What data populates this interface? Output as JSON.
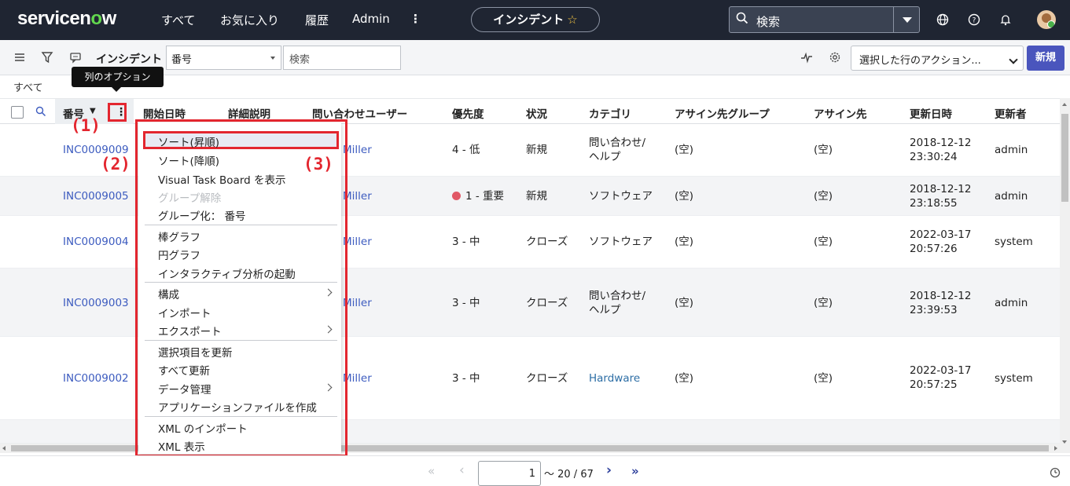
{
  "nav": {
    "logo_pre": "servicen",
    "logo_o": "o",
    "logo_post": "w",
    "links": [
      "すべて",
      "お気に入り",
      "履歴",
      "Admin"
    ],
    "title_pill": "インシデント",
    "search_text": "検索"
  },
  "toolbar": {
    "title": "インシデント",
    "field_select": "番号",
    "search_placeholder": "検索",
    "action_select": "選択した行のアクション...",
    "new_button": "新規"
  },
  "breadcrumb": "すべて",
  "tooltip": "列のオプション",
  "columns": [
    "番号",
    "開始日時",
    "詳細説明",
    "問い合わせユーザー",
    "優先度",
    "状況",
    "カテゴリ",
    "アサイン先グループ",
    "アサイン先",
    "更新日時",
    "更新者"
  ],
  "rows": [
    {
      "number": "INC0009009",
      "caller": "Miller",
      "priority": "4 - 低",
      "critical": false,
      "state": "新規",
      "category1": "問い合わせ/",
      "category2": "ヘルプ",
      "category_link": false,
      "group": "(空)",
      "assignee": "(空)",
      "updated1": "2018-12-12",
      "updated2": "23:30:24",
      "updated_by": "admin"
    },
    {
      "number": "INC0009005",
      "caller": "Miller",
      "priority": "1 - 重要",
      "critical": true,
      "state": "新規",
      "category1": "ソフトウェア",
      "category2": "",
      "category_link": false,
      "group": "(空)",
      "assignee": "(空)",
      "updated1": "2018-12-12",
      "updated2": "23:18:55",
      "updated_by": "admin"
    },
    {
      "number": "INC0009004",
      "caller": "Miller",
      "priority": "3 - 中",
      "critical": false,
      "state": "クローズ",
      "category1": "ソフトウェア",
      "category2": "",
      "category_link": false,
      "group": "(空)",
      "assignee": "(空)",
      "updated1": "2022-03-17",
      "updated2": "20:57:26",
      "updated_by": "system"
    },
    {
      "number": "INC0009003",
      "caller": "Miller",
      "priority": "3 - 中",
      "critical": false,
      "state": "クローズ",
      "category1": "問い合わせ/",
      "category2": "ヘルプ",
      "category_link": false,
      "group": "(空)",
      "assignee": "(空)",
      "updated1": "2018-12-12",
      "updated2": "23:39:53",
      "updated_by": "admin"
    },
    {
      "number": "INC0009002",
      "caller": "Miller",
      "priority": "3 - 中",
      "critical": false,
      "state": "クローズ",
      "category1": "Hardware",
      "category2": "",
      "category_link": true,
      "group": "(空)",
      "assignee": "(空)",
      "updated1": "2022-03-17",
      "updated2": "20:57:25",
      "updated_by": "system"
    }
  ],
  "menu": {
    "items": [
      {
        "label": "ソート(昇順)",
        "disabled": false,
        "submenu": false
      },
      {
        "label": "ソート(降順)",
        "disabled": false,
        "submenu": false
      },
      {
        "label": "Visual Task Board を表示",
        "disabled": false,
        "submenu": false
      },
      {
        "label": "グループ解除",
        "disabled": true,
        "submenu": false
      },
      {
        "label": "グループ化： 番号",
        "disabled": false,
        "submenu": false
      },
      {
        "label": "棒グラフ",
        "disabled": false,
        "submenu": false
      },
      {
        "label": "円グラフ",
        "disabled": false,
        "submenu": false
      },
      {
        "label": "インタラクティブ分析の起動",
        "disabled": false,
        "submenu": false
      },
      {
        "label": "構成",
        "disabled": false,
        "submenu": true
      },
      {
        "label": "インポート",
        "disabled": false,
        "submenu": false
      },
      {
        "label": "エクスポート",
        "disabled": false,
        "submenu": true
      },
      {
        "label": "選択項目を更新",
        "disabled": false,
        "submenu": false
      },
      {
        "label": "すべて更新",
        "disabled": false,
        "submenu": false
      },
      {
        "label": "データ管理",
        "disabled": false,
        "submenu": true
      },
      {
        "label": "アプリケーションファイルを作成",
        "disabled": false,
        "submenu": false
      },
      {
        "label": "XML のインポート",
        "disabled": false,
        "submenu": false
      },
      {
        "label": "XML 表示",
        "disabled": false,
        "submenu": false
      }
    ]
  },
  "annotations": [
    "(1)",
    "(2)",
    "(3)"
  ],
  "pager": {
    "first": "«",
    "prev": "‹",
    "page": "1",
    "range": "～ 20 / 67",
    "next": "›",
    "last": "»"
  },
  "colors": {
    "accent": "#4a55bd",
    "highlight": "#e3262f",
    "critical": "#e15866",
    "link": "#3c5bbf",
    "nav_bg": "#1f2532"
  }
}
